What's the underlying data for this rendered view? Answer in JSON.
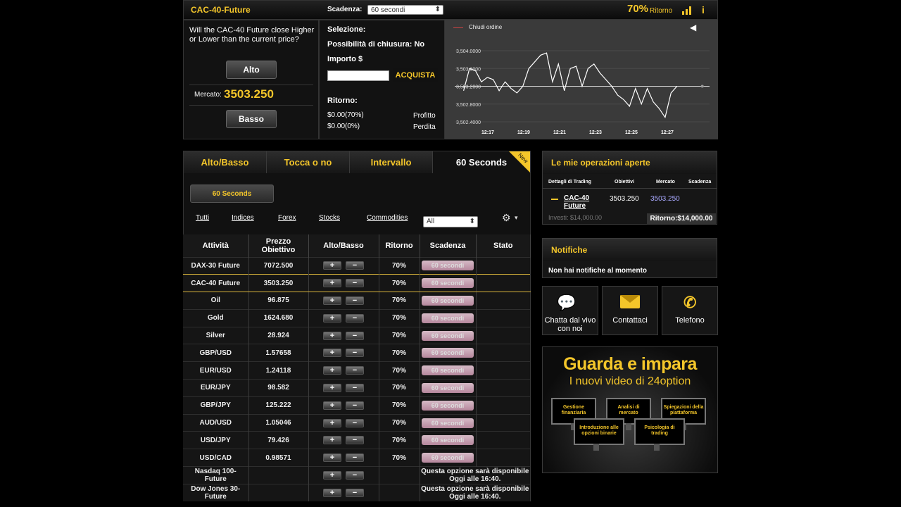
{
  "header": {
    "asset": "CAC-40-Future",
    "expiry_label": "Scadenza:",
    "expiry_value": "60 secondi",
    "percent": "70%",
    "return_label": "Ritorno"
  },
  "question": {
    "text": "Will the CAC-40 Future close Higher or Lower than the current price?",
    "high_btn": "Alto",
    "low_btn": "Basso",
    "market_label": "Mercato:",
    "market_value": "3503.250"
  },
  "order": {
    "selection_label": "Selezione:",
    "close_possibility": "Possibilità di chiusura: No",
    "amount_label": "Importo $",
    "amount_value": "",
    "buy_btn": "ACQUISTA",
    "return_label": "Ritorno:",
    "profit_value": "$0.00(70%)",
    "profit_label": "Profitto",
    "loss_value": "$0.00(0%)",
    "loss_label": "Perdita"
  },
  "chart_data": {
    "type": "line",
    "legend": "Chiudi ordine",
    "x_ticks": [
      "12:17",
      "12:19",
      "12:21",
      "12:23",
      "12:25",
      "12:27"
    ],
    "y_ticks": [
      "3,504.0000",
      "3,503.6000",
      "3,503.2000",
      "3,502.8000",
      "3,502.4000"
    ],
    "ylim": [
      3502.4,
      3504.0
    ],
    "x": [
      12.15,
      12.25,
      12.35,
      12.45,
      12.55,
      12.65,
      12.75,
      12.85,
      12.95,
      13.05,
      13.15,
      13.25,
      13.35,
      13.45,
      13.55,
      13.65,
      13.75,
      13.85,
      13.95,
      14.05,
      14.15,
      14.25,
      14.35,
      14.45,
      14.55,
      14.65,
      14.75,
      14.85,
      14.95,
      15.05,
      15.15,
      15.25,
      15.35,
      15.45,
      15.55,
      15.65,
      15.75
    ],
    "y": [
      3503.1,
      3503.6,
      3503.55,
      3503.3,
      3503.4,
      3503.35,
      3503.1,
      3503.3,
      3503.15,
      3503.05,
      3503.2,
      3503.6,
      3503.75,
      3503.9,
      3503.95,
      3503.3,
      3503.7,
      3503.1,
      3503.6,
      3503.65,
      3503.2,
      3503.6,
      3503.7,
      3503.5,
      3503.35,
      3503.2,
      3503.0,
      3502.9,
      3502.75,
      3503.15,
      3502.8,
      3503.15,
      3502.85,
      3502.7,
      3502.5,
      3503.05,
      3503.2
    ],
    "current_level": 3503.2
  },
  "tabs": [
    "Alto/Basso",
    "Tocca o no",
    "Intervallo",
    "60 Seconds"
  ],
  "new_badge": "New",
  "seconds_btn": "60 Seconds",
  "filters": [
    "Tutti",
    "Indices",
    "Forex",
    "Stocks",
    "Commodities"
  ],
  "filter_select": "All",
  "table": {
    "headers": [
      "Attività",
      "Prezzo Obiettivo",
      "Alto/Basso",
      "Ritorno",
      "Scadenza",
      "Stato"
    ],
    "rows": [
      {
        "asset": "DAX-30 Future",
        "price": "7072.500",
        "ret": "70%",
        "exp": "60 secondi"
      },
      {
        "asset": "CAC-40 Future",
        "price": "3503.250",
        "ret": "70%",
        "exp": "60 secondi"
      },
      {
        "asset": "Oil",
        "price": "96.875",
        "ret": "70%",
        "exp": "60 secondi"
      },
      {
        "asset": "Gold",
        "price": "1624.680",
        "ret": "70%",
        "exp": "60 secondi"
      },
      {
        "asset": "Silver",
        "price": "28.924",
        "ret": "70%",
        "exp": "60 secondi"
      },
      {
        "asset": "GBP/USD",
        "price": "1.57658",
        "ret": "70%",
        "exp": "60 secondi"
      },
      {
        "asset": "EUR/USD",
        "price": "1.24118",
        "ret": "70%",
        "exp": "60 secondi"
      },
      {
        "asset": "EUR/JPY",
        "price": "98.582",
        "ret": "70%",
        "exp": "60 secondi"
      },
      {
        "asset": "GBP/JPY",
        "price": "125.222",
        "ret": "70%",
        "exp": "60 secondi"
      },
      {
        "asset": "AUD/USD",
        "price": "1.05046",
        "ret": "70%",
        "exp": "60 secondi"
      },
      {
        "asset": "USD/JPY",
        "price": "79.426",
        "ret": "70%",
        "exp": "60 secondi"
      },
      {
        "asset": "USD/CAD",
        "price": "0.98571",
        "ret": "70%",
        "exp": "60 secondi"
      }
    ],
    "unavailable": [
      {
        "asset": "Nasdaq 100- Future",
        "note": "Questa opzione sarà disponibile Oggi alle 16:40."
      },
      {
        "asset": "Dow Jones 30- Future",
        "note": "Questa opzione sarà disponibile Oggi alle 16:40."
      }
    ],
    "plus": "+",
    "minus": "−"
  },
  "open_trades": {
    "title": "Le mie operazioni aperte",
    "headers": [
      "Dettagli di Trading",
      "Obiettivi",
      "Mercato",
      "Scadenza"
    ],
    "asset": "CAC-40 Future",
    "invest": "Investi: $14,000.00",
    "target": "3503.250",
    "market": "3503.250",
    "return": "Ritorno:$14,000.00"
  },
  "notifications": {
    "title": "Notifiche",
    "text": "Non hai notifiche al momento"
  },
  "contact": [
    {
      "label": "Chatta dal vivo con noi",
      "icon": "chat-icon"
    },
    {
      "label": "Contattaci",
      "icon": "mail-icon"
    },
    {
      "label": "Telefono",
      "icon": "phone-icon"
    }
  ],
  "promo": {
    "title": "Guarda e impara",
    "subtitle": "I nuovi video di 24option",
    "monitors": [
      "Gestione finanziaria",
      "Analisi di mercato",
      "Spiegazioni della piattaforma",
      "Introduzione alle opzioni binarie",
      "Psicologia di trading"
    ]
  }
}
